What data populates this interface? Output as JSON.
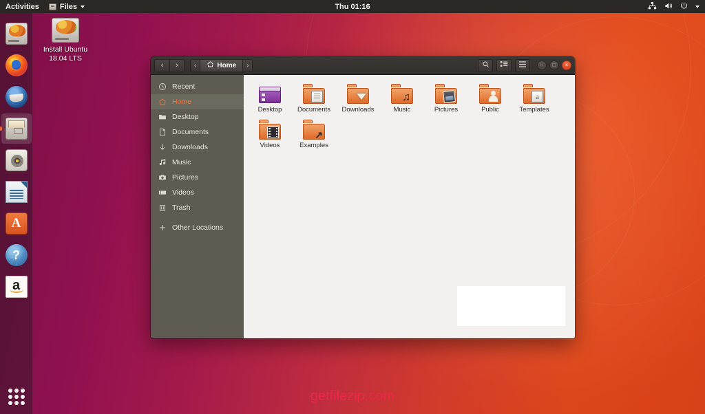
{
  "topbar": {
    "activities_label": "Activities",
    "app_menu_label": "Files",
    "app_menu_icon": "files-icon",
    "clock": "Thu 01:16",
    "indicators": [
      {
        "name": "network-icon",
        "glyph": "⚬"
      },
      {
        "name": "volume-icon",
        "glyph": "◂"
      },
      {
        "name": "power-icon",
        "glyph": "⏻"
      },
      {
        "name": "system-menu-caret-icon",
        "glyph": "▾"
      }
    ]
  },
  "dock": {
    "items": [
      {
        "name": "ubuntu-installer",
        "icon": "ic-installer",
        "active": false
      },
      {
        "name": "firefox",
        "icon": "ic-firefox",
        "active": false
      },
      {
        "name": "thunderbird",
        "icon": "ic-thunderbird",
        "active": false
      },
      {
        "name": "files",
        "icon": "ic-files",
        "active": true
      },
      {
        "name": "rhythmbox",
        "icon": "ic-rhythmbox",
        "active": false
      },
      {
        "name": "libreoffice-writer",
        "icon": "ic-writer",
        "active": false
      },
      {
        "name": "ubuntu-software",
        "icon": "ic-software",
        "active": false
      },
      {
        "name": "help",
        "icon": "ic-help",
        "active": false
      },
      {
        "name": "amazon",
        "icon": "ic-amazon",
        "active": false
      }
    ],
    "show_applications_label": "Show Applications"
  },
  "desktop": {
    "icon_label": "Install Ubuntu 18.04 LTS",
    "icon_name": "install-ubuntu-icon",
    "wallpaper_colors": {
      "left": "#8b1046",
      "right": "#dd4418"
    }
  },
  "window": {
    "headerbar": {
      "back_glyph": "‹",
      "forward_glyph": "›",
      "path_prev_glyph": "‹",
      "path_next_glyph": "›",
      "current_path_label": "Home",
      "search_glyph": "⌕",
      "view_toggle_glyph": "☲",
      "menu_glyph": "☰",
      "minimize_glyph": "−",
      "maximize_glyph": "□",
      "close_glyph": "×"
    },
    "sidebar": {
      "items": [
        {
          "label": "Recent",
          "icon": "clock-icon",
          "selected": false
        },
        {
          "label": "Home",
          "icon": "home-icon",
          "selected": true
        },
        {
          "label": "Desktop",
          "icon": "folder-icon",
          "selected": false
        },
        {
          "label": "Documents",
          "icon": "document-icon",
          "selected": false
        },
        {
          "label": "Downloads",
          "icon": "download-arrow-icon",
          "selected": false
        },
        {
          "label": "Music",
          "icon": "music-note-icon",
          "selected": false
        },
        {
          "label": "Pictures",
          "icon": "camera-icon",
          "selected": false
        },
        {
          "label": "Videos",
          "icon": "film-icon",
          "selected": false
        },
        {
          "label": "Trash",
          "icon": "trash-icon",
          "selected": false
        },
        {
          "label": "Other Locations",
          "icon": "plus-icon",
          "selected": false,
          "separated": true
        }
      ]
    },
    "files": [
      {
        "label": "Desktop",
        "kind": "desktop"
      },
      {
        "label": "Documents",
        "kind": "folder",
        "emblem": "emb-doc"
      },
      {
        "label": "Downloads",
        "kind": "folder",
        "emblem": "emb-dl"
      },
      {
        "label": "Music",
        "kind": "folder",
        "emblem": "emb-music"
      },
      {
        "label": "Pictures",
        "kind": "folder",
        "emblem": "emb-pic"
      },
      {
        "label": "Public",
        "kind": "folder",
        "emblem": "emb-user"
      },
      {
        "label": "Templates",
        "kind": "folder",
        "emblem": "emb-tpl"
      },
      {
        "label": "Videos",
        "kind": "folder",
        "emblem": "emb-film"
      },
      {
        "label": "Examples",
        "kind": "folder",
        "emblem": "emb-link"
      }
    ]
  },
  "watermark": {
    "text": "getfilezip.com",
    "color": "#f0274b"
  }
}
